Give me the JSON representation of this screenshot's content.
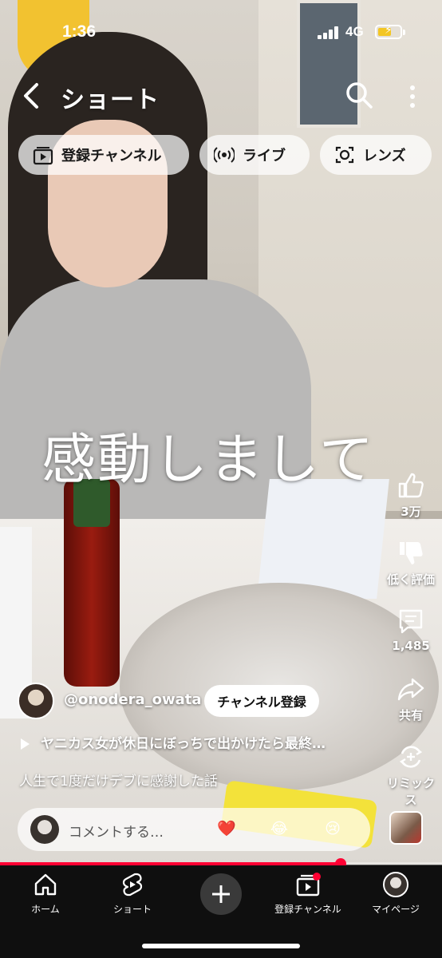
{
  "status_bar": {
    "time": "1:36",
    "network": "4G"
  },
  "header": {
    "title": "ショート"
  },
  "chips": [
    {
      "label": "登録チャンネル",
      "icon": "subscriptions-icon"
    },
    {
      "label": "ライブ",
      "icon": "live-icon"
    },
    {
      "label": "レンズ",
      "icon": "lens-icon"
    }
  ],
  "video": {
    "caption": "感動しまして"
  },
  "actions": {
    "like": "3万",
    "dislike": "低く評価",
    "comments": "1,485",
    "share": "共有",
    "remix": "リミックス"
  },
  "channel": {
    "handle": "@onodera_owata",
    "subscribe_label": "チャンネル登録"
  },
  "playlist_title": "ヤニカス女が休日にぼっちで出かけたら最終…",
  "description": "人生で1度だけデブに感謝した話",
  "comment": {
    "placeholder": "コメントする…",
    "reactions": [
      "❤️",
      "😂",
      "😢"
    ]
  },
  "progress": {
    "played_fraction": 0.77
  },
  "nav": [
    {
      "label": "ホーム",
      "icon": "home-icon"
    },
    {
      "label": "ショート",
      "icon": "shorts-icon"
    },
    {
      "label": "",
      "icon": "create-icon"
    },
    {
      "label": "登録チャンネル",
      "icon": "subscriptions-icon"
    },
    {
      "label": "マイページ",
      "icon": "avatar"
    }
  ],
  "colors": {
    "accent": "#ff0033",
    "nav_bg": "#0f0f0f"
  }
}
